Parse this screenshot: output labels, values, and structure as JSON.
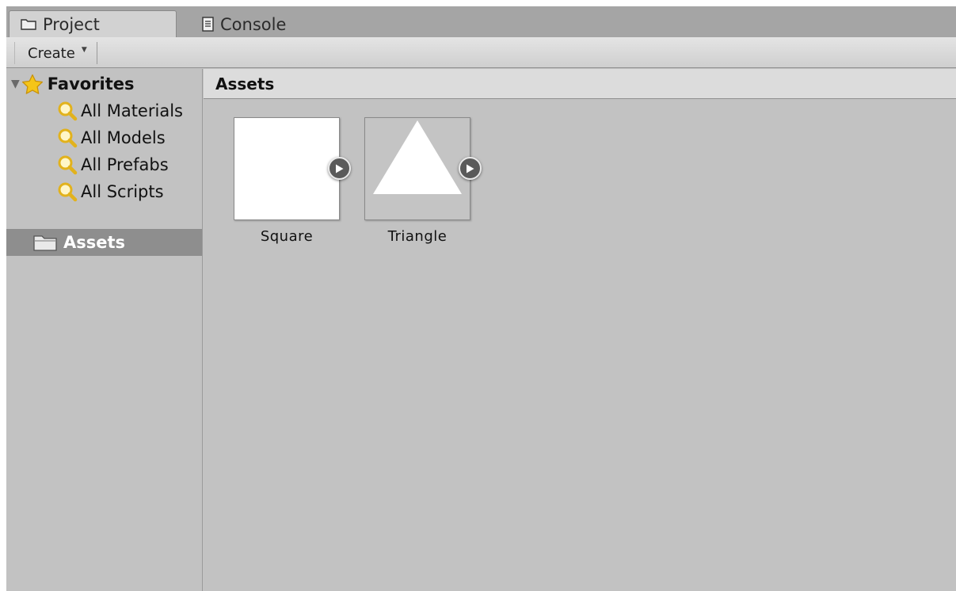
{
  "tabs": [
    {
      "label": "Project",
      "icon": "folder-icon",
      "active": true
    },
    {
      "label": "Console",
      "icon": "console-icon",
      "active": false
    }
  ],
  "toolbar": {
    "create_label": "Create"
  },
  "tree": {
    "favorites": {
      "label": "Favorites",
      "icon": "star-icon",
      "items": [
        {
          "label": "All Materials",
          "icon": "search-icon"
        },
        {
          "label": "All Models",
          "icon": "search-icon"
        },
        {
          "label": "All Prefabs",
          "icon": "search-icon"
        },
        {
          "label": "All Scripts",
          "icon": "search-icon"
        }
      ]
    },
    "assets": {
      "label": "Assets",
      "icon": "folder-icon",
      "selected": true
    }
  },
  "main": {
    "title": "Assets",
    "items": [
      {
        "label": "Square",
        "thumbnail": "white-square"
      },
      {
        "label": "Triangle",
        "thumbnail": "white-triangle"
      }
    ]
  },
  "colors": {
    "panel_bg": "#c2c2c2",
    "selected_row": "#8e8e8e",
    "favorite_star": "#f5c518",
    "search_icon": "#e2b21c"
  }
}
